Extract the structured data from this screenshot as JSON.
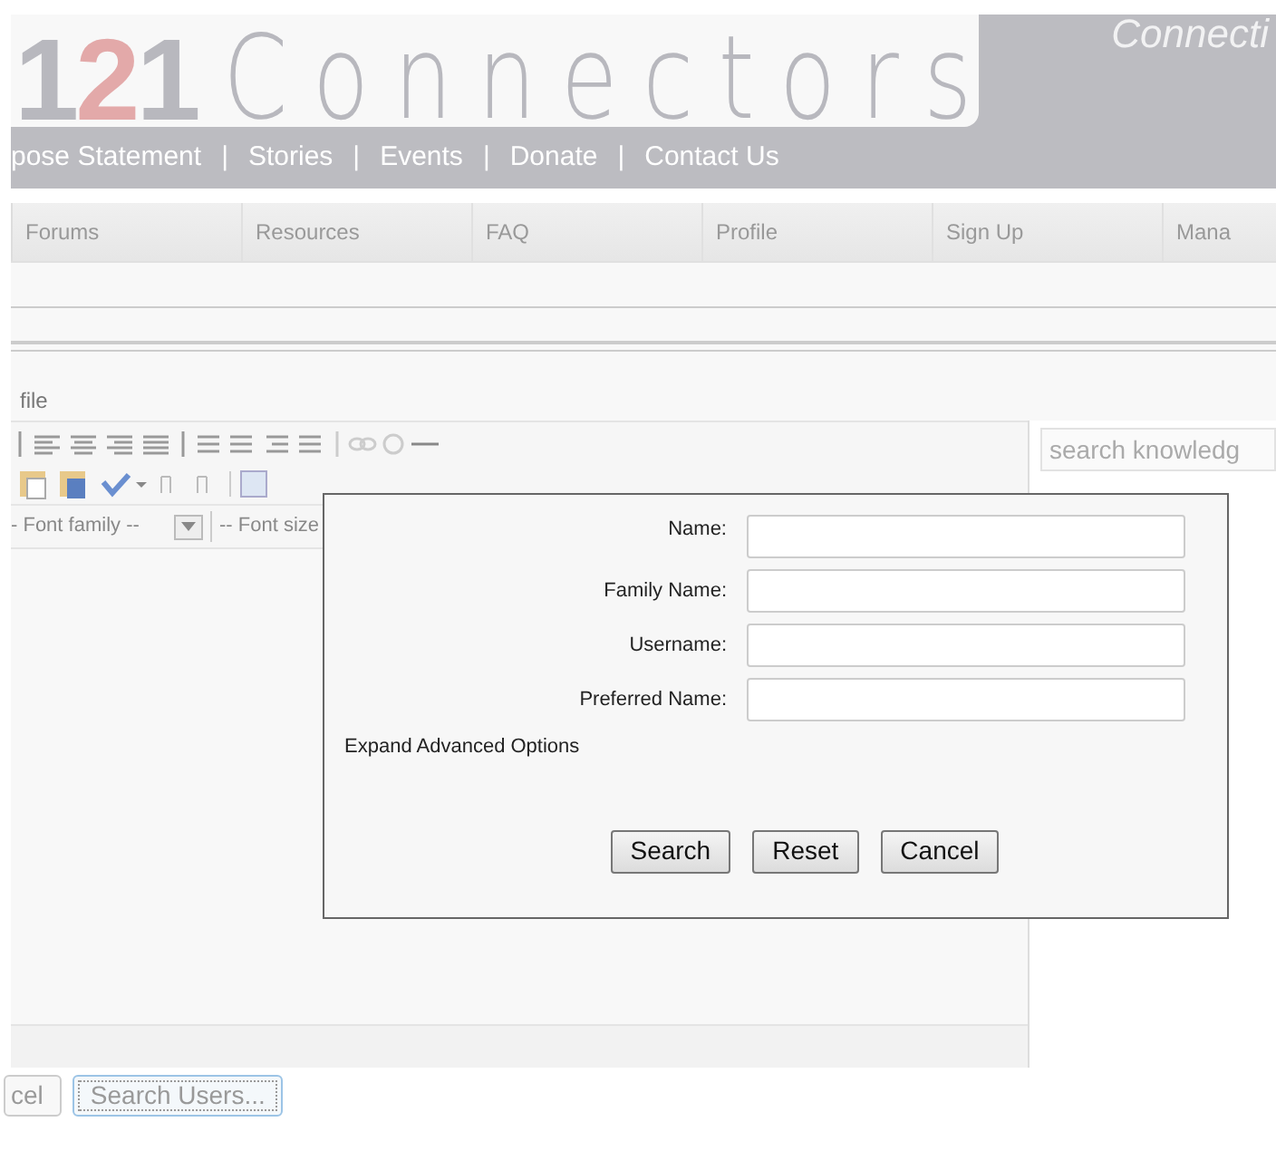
{
  "header": {
    "logo_digits": [
      {
        "text": "1",
        "color": "#b8b8be"
      },
      {
        "text": "2",
        "color": "#e3a9a9"
      },
      {
        "text": "1",
        "color": "#b8b8be"
      }
    ],
    "logo_word": "Connectors",
    "tagline": "Connecti",
    "nav": [
      {
        "kind": "link",
        "text": "pose Statement"
      },
      {
        "kind": "separator",
        "text": "|"
      },
      {
        "kind": "link",
        "text": "Stories"
      },
      {
        "kind": "separator",
        "text": "|"
      },
      {
        "kind": "link",
        "text": "Events"
      },
      {
        "kind": "separator",
        "text": "|"
      },
      {
        "kind": "link",
        "text": "Donate"
      },
      {
        "kind": "separator",
        "text": "|"
      },
      {
        "kind": "link",
        "text": "Contact Us"
      }
    ]
  },
  "tabs": [
    "Forums",
    "Resources",
    "FAQ",
    "Profile",
    "Sign Up",
    "Mana"
  ],
  "menu_label": "file",
  "editor": {
    "font_family": "- Font family --",
    "font_size": "-- Font size"
  },
  "sidebar": {
    "search_placeholder": "search knowledg"
  },
  "dialog": {
    "fields": [
      {
        "label": "Name:"
      },
      {
        "label": "Family Name:"
      },
      {
        "label": "Username:"
      },
      {
        "label": "Preferred Name:"
      }
    ],
    "advanced_link": "Expand Advanced Options",
    "buttons": [
      "Search",
      "Reset",
      "Cancel"
    ]
  },
  "bottom_buttons": [
    {
      "label": "cel",
      "focused": false
    },
    {
      "label": "Search Users...",
      "focused": true
    }
  ]
}
